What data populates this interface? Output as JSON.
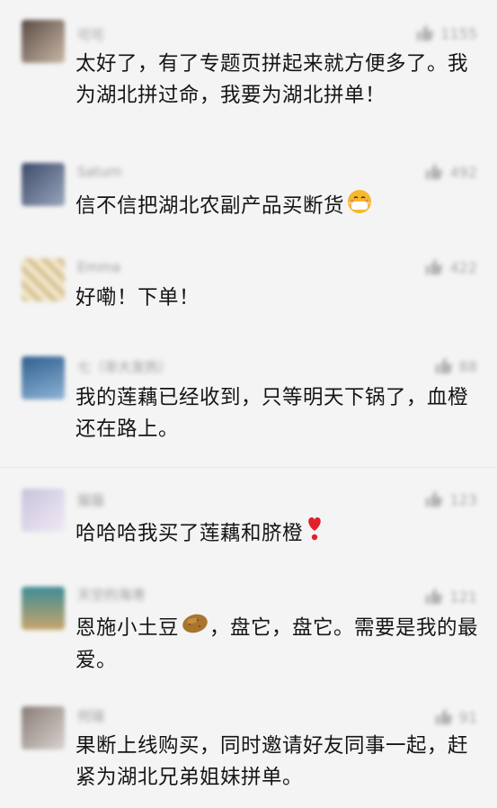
{
  "comments": [
    {
      "username": "可可",
      "likes": "1155",
      "text": "太好了，有了专题页拼起来就方便多了。我为湖北拼过命，我要为湖北拼单！",
      "avatar_colors": [
        "#5a4a44",
        "#c9b7a6"
      ]
    },
    {
      "username": "Saturn",
      "likes": "492",
      "text": "信不信把湖北农副产品买断货",
      "emoji": "mask-smile-emoji",
      "avatar_colors": [
        "#3c4a6a",
        "#9aa6bd"
      ]
    },
    {
      "username": "Emma",
      "likes": "422",
      "text": "好嘞！下单！",
      "avatar_colors": [
        "#d9c497",
        "#f2e8cc"
      ]
    },
    {
      "username": "七（非大发热）",
      "likes": "88",
      "text": "我的莲藕已经收到，只等明天下锅了，血橙还在路上。",
      "avatar_colors": [
        "#2f5e8e",
        "#8fb4d6"
      ]
    },
    {
      "username": "猫猫",
      "likes": "123",
      "text": "哈哈哈我买了莲藕和脐橙",
      "emoji": "heart-exclamation-emoji",
      "avatar_colors": [
        "#c9c3dc",
        "#efe9f4"
      ]
    },
    {
      "username": "天空的海港",
      "likes": "121",
      "text": "恩施小土豆",
      "text_after": "，盘它，盘它。需要是我的最爱。",
      "emoji": "potato-emoji",
      "avatar_colors": [
        "#3e8c96",
        "#c8a46a"
      ]
    },
    {
      "username": "何瑞",
      "likes": "91",
      "text": "果断上线购买，同时邀请好友同事一起，赶紧为湖北兄弟姐妹拼单。",
      "avatar_colors": [
        "#8a7d78",
        "#d8d2ce"
      ]
    }
  ]
}
